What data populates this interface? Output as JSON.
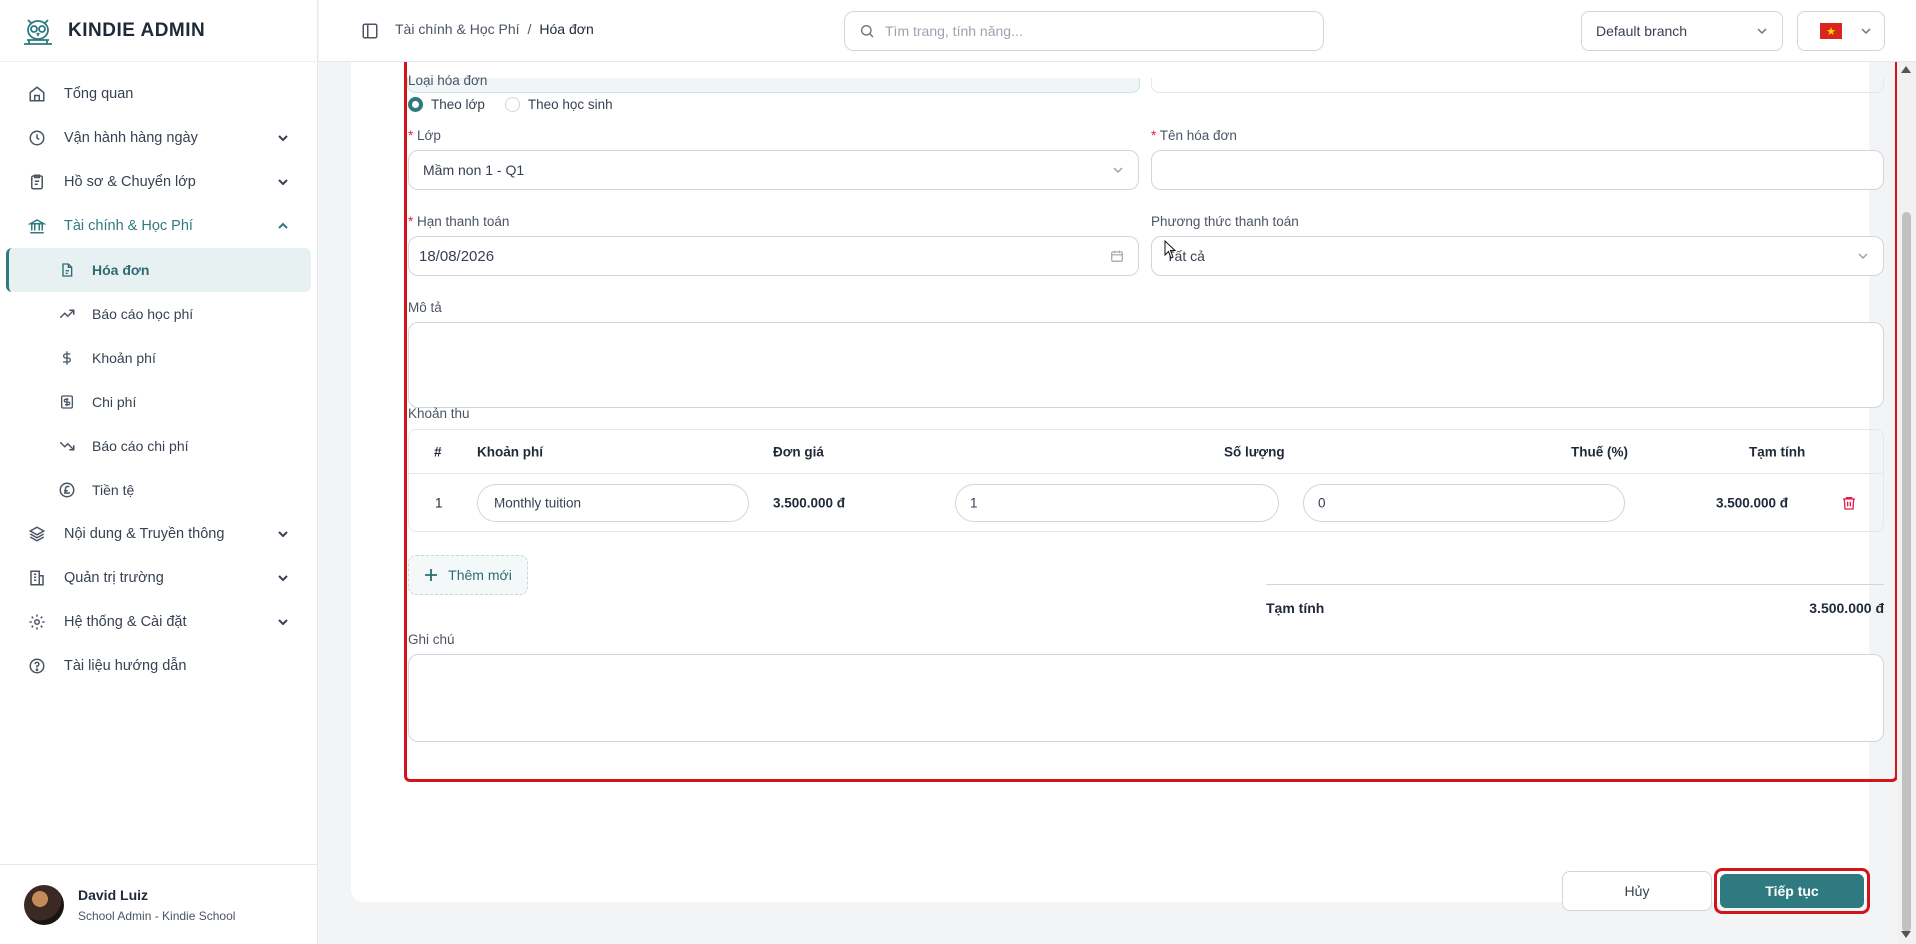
{
  "brand": {
    "name": "KINDIE ADMIN"
  },
  "sidebar": {
    "items": [
      {
        "label": "Tổng quan",
        "icon": "home-icon",
        "has_children": false
      },
      {
        "label": "Vận hành hàng ngày",
        "icon": "clock-icon",
        "has_children": true
      },
      {
        "label": "Hồ sơ & Chuyển lớp",
        "icon": "clipboard-icon",
        "has_children": true
      },
      {
        "label": "Tài chính & Học Phí",
        "icon": "bank-icon",
        "has_children": true,
        "open": true
      },
      {
        "label": "Nội dung & Truyền thông",
        "icon": "layers-icon",
        "has_children": true
      },
      {
        "label": "Quản trị trường",
        "icon": "building-icon",
        "has_children": true
      },
      {
        "label": "Hệ thống & Cài đặt",
        "icon": "gear-icon",
        "has_children": true
      },
      {
        "label": "Tài liệu hướng dẫn",
        "icon": "help-icon",
        "has_children": false
      }
    ],
    "sub_items": [
      {
        "label": "Hóa đơn",
        "icon": "invoice-icon",
        "active": true
      },
      {
        "label": "Báo cáo học phí",
        "icon": "trend-up-icon"
      },
      {
        "label": "Khoản phí",
        "icon": "dollar-icon"
      },
      {
        "label": "Chi phí",
        "icon": "receipt-icon"
      },
      {
        "label": "Báo cáo chi phí",
        "icon": "trend-down-icon"
      },
      {
        "label": "Tiền tệ",
        "icon": "currency-icon"
      }
    ]
  },
  "user": {
    "name": "David Luiz",
    "role": "School Admin - Kindie School"
  },
  "header": {
    "breadcrumb": [
      "Tài chính & Học Phí",
      "/",
      "Hóa đơn"
    ],
    "search_placeholder": "Tìm trang, tính năng...",
    "branch": "Default branch"
  },
  "form": {
    "invoice_type_label": "Loại hóa đơn",
    "invoice_type_options": [
      "Theo lớp",
      "Theo học sinh"
    ],
    "invoice_type_selected": "Theo lớp",
    "class_label": "Lớp",
    "class_value": "Mầm non 1 - Q1",
    "invoice_name_label": "Tên hóa đơn",
    "invoice_name_value": "",
    "due_date_label": "Hạn thanh toán",
    "due_date_value": "18/08/2026",
    "payment_method_label": "Phương thức thanh toán",
    "payment_method_value": "Tất cả",
    "description_label": "Mô tả",
    "items_label": "Khoản thu",
    "notes_label": "Ghi chú",
    "add_new_label": "Thêm mới",
    "subtotal_label": "Tạm tính",
    "subtotal_value": "3.500.000 đ"
  },
  "table": {
    "headers": {
      "index": "#",
      "fee": "Khoản phí",
      "unit_price": "Đơn giá",
      "quantity": "Số lượng",
      "tax": "Thuế (%)",
      "subtotal": "Tạm tính"
    },
    "rows": [
      {
        "index": "1",
        "fee": "Monthly tuition",
        "unit_price": "3.500.000 đ",
        "quantity": "1",
        "tax": "0",
        "subtotal": "3.500.000 đ"
      }
    ]
  },
  "actions": {
    "cancel": "Hủy",
    "continue": "Tiếp tục"
  },
  "colors": {
    "accent": "#2f7a80",
    "highlight": "#d0151b",
    "danger": "#e11d48"
  }
}
